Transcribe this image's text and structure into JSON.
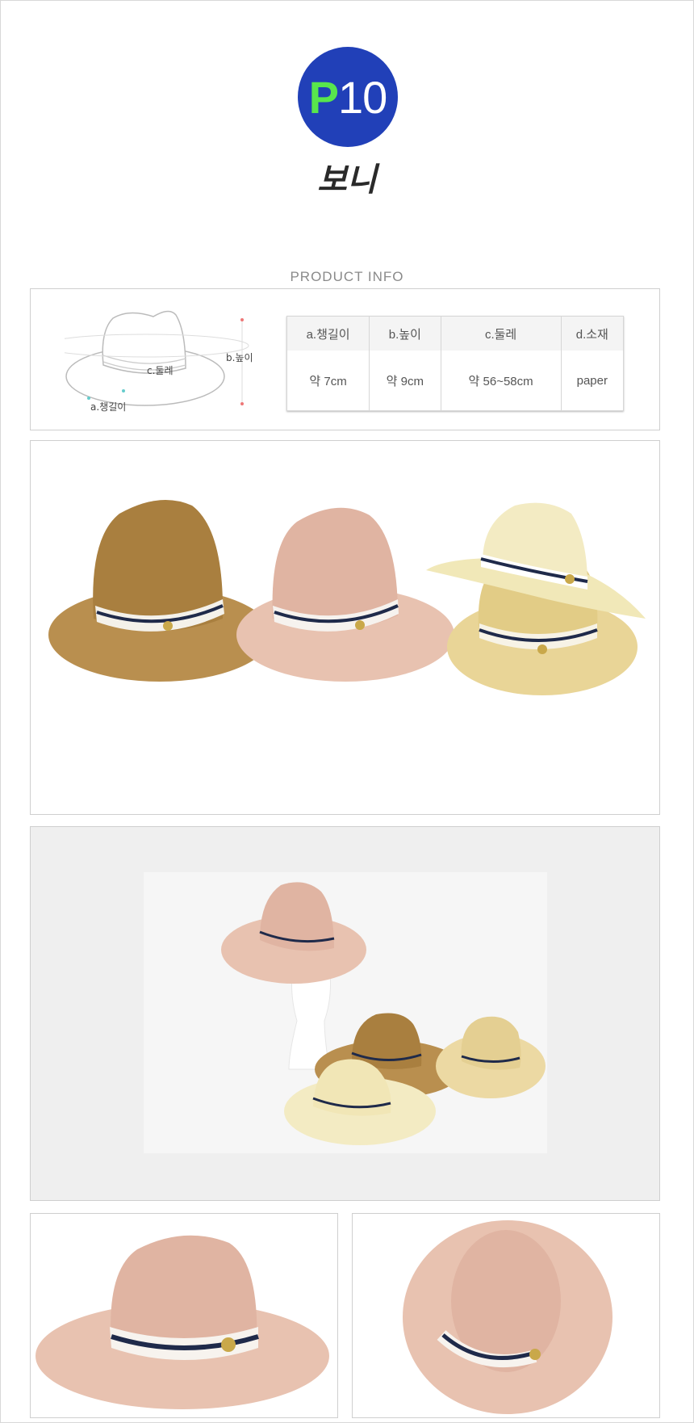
{
  "product": {
    "code_letter": "P",
    "code_number": "10",
    "name": "보니"
  },
  "info_label": "PRODUCT  INFO",
  "diagram_labels": {
    "brim": "a.챙길이",
    "height": "b.높이",
    "circumference": "c.둘레"
  },
  "spec_table": {
    "headers": [
      "a.챙길이",
      "b.높이",
      "c.둘레",
      "d.소재"
    ],
    "values": [
      "약 7cm",
      "약 9cm",
      "약 56~58cm",
      "paper"
    ]
  },
  "colors": {
    "badge": "#2140b8",
    "badge_letter": "#58e64c",
    "hat_brown": "#b98f4f",
    "hat_pink": "#e8c2b0",
    "hat_cream": "#f1e8b8",
    "hat_beige": "#e9d597",
    "band_navy": "#1f2a4a"
  }
}
